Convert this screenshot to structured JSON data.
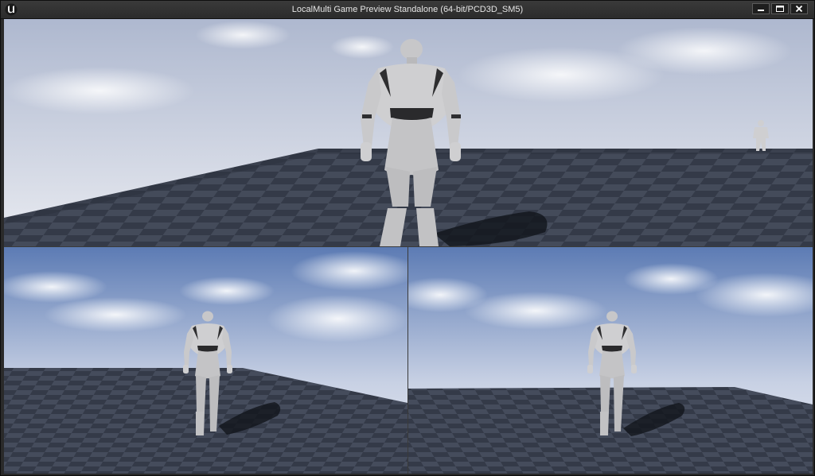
{
  "window": {
    "title": "LocalMulti Game Preview Standalone (64-bit/PCD3D_SM5)",
    "logo_icon": "unreal-engine-logo",
    "controls": [
      "minimize-icon",
      "maximize-icon",
      "close-icon"
    ]
  },
  "viewports": [
    {
      "name": "player-1-viewport",
      "characters": [
        "mannequin-near",
        "mannequin-far"
      ]
    },
    {
      "name": "player-2-viewport",
      "characters": [
        "mannequin"
      ]
    },
    {
      "name": "player-3-viewport",
      "characters": [
        "mannequin"
      ]
    }
  ],
  "colors": {
    "sky_top": "#5f7fb8",
    "sky_bottom": "#e9ecf3",
    "floor_dark": "#2f3543",
    "floor_light": "#4a5162",
    "mannequin": "#c9c9cb"
  }
}
